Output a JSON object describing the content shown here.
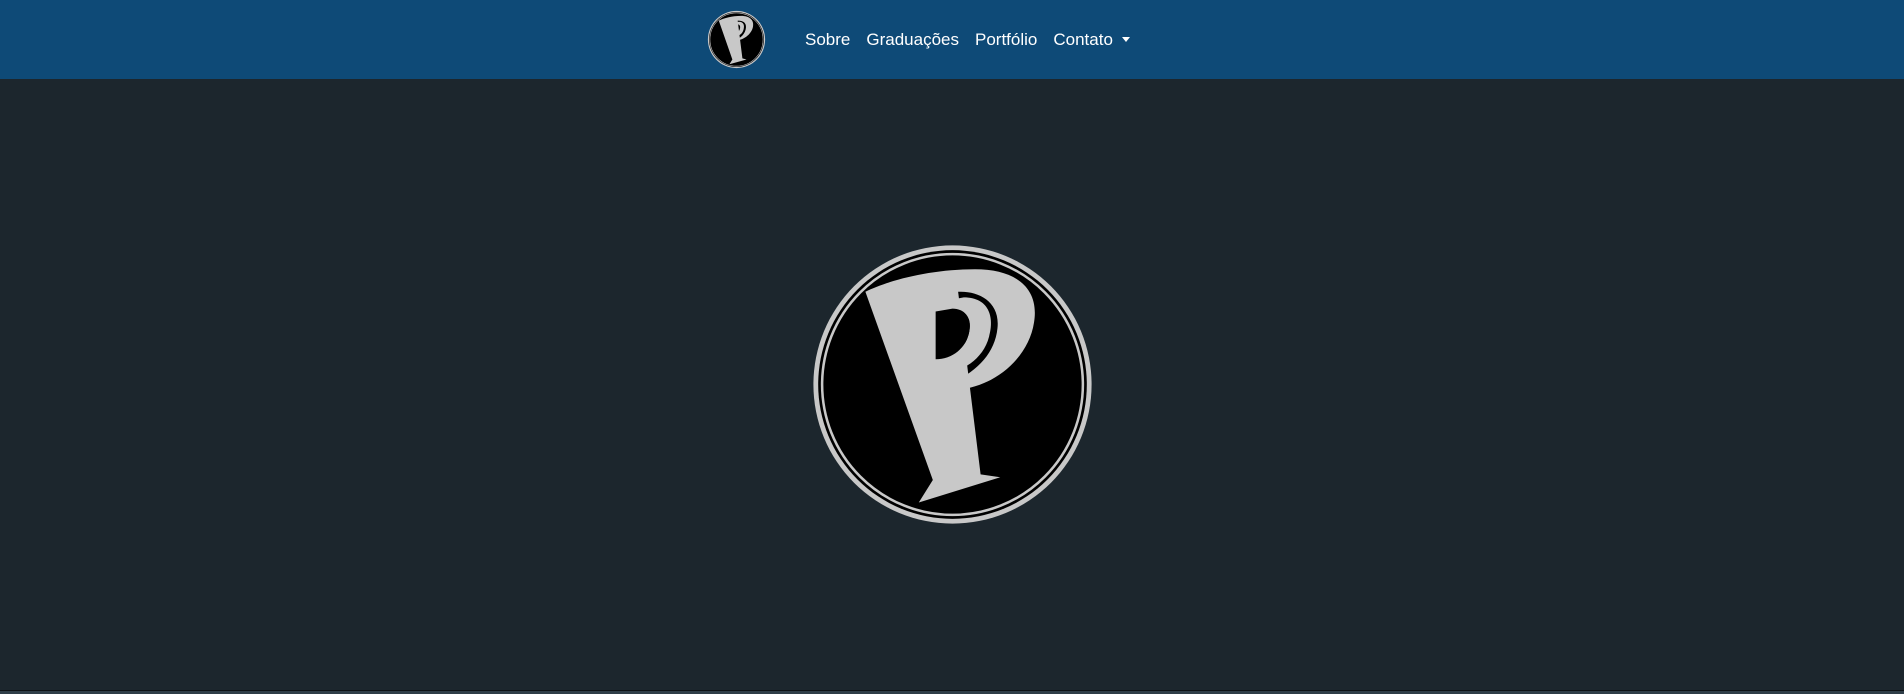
{
  "navbar": {
    "brand": {
      "logo_letter": "P",
      "logo_icon": "p-monogram-logo-icon"
    },
    "items": [
      {
        "label": "Sobre"
      },
      {
        "label": "Graduações"
      },
      {
        "label": "Portfólio"
      },
      {
        "label": "Contato",
        "has_dropdown": true,
        "dropdown_icon": "caret-down-icon"
      }
    ]
  },
  "hero": {
    "logo_letter": "P",
    "logo_icon": "p-monogram-logo-icon"
  },
  "colors": {
    "navbar_bg": "#0e4a77",
    "page_bg": "#1c262d",
    "logo_fill": "#000000",
    "logo_accent": "#c8c8c8",
    "nav_text": "#ffffff"
  }
}
